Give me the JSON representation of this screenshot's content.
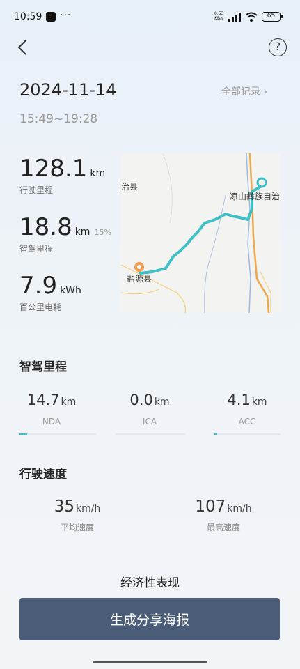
{
  "status": {
    "time": "10:59",
    "dots": "···",
    "speed_top": "0.53",
    "speed_bottom": "KB/s",
    "battery": "65"
  },
  "header": {
    "help_icon": "question-icon",
    "back_icon": "chevron-left-icon"
  },
  "trip": {
    "date": "2024-11-14",
    "time_range": "15:49~19:28",
    "all_records": "全部记录 ›"
  },
  "stats": {
    "distance": {
      "value": "128.1",
      "unit": "km",
      "label": "行驶里程"
    },
    "smart": {
      "value": "18.8",
      "unit": "km",
      "pct": "15%",
      "label": "智驾里程"
    },
    "energy": {
      "value": "7.9",
      "unit": "kWh",
      "label": "百公里电耗"
    }
  },
  "map": {
    "label_top_left": "治县",
    "label_top_right": "凉山彝族自治",
    "label_start": "盐源县"
  },
  "smart_driving": {
    "title": "智驾里程",
    "items": [
      {
        "value": "14.7",
        "unit": "km",
        "label": "NDA",
        "fill": 0.1
      },
      {
        "value": "0.0",
        "unit": "km",
        "label": "ICA",
        "fill": 0.0
      },
      {
        "value": "4.1",
        "unit": "km",
        "label": "ACC",
        "fill": 0.03
      }
    ]
  },
  "speed": {
    "title": "行驶速度",
    "avg": {
      "value": "35",
      "unit": "km/h",
      "label": "平均速度"
    },
    "max": {
      "value": "107",
      "unit": "km/h",
      "label": "最高速度"
    }
  },
  "economy": {
    "title": "经济性表现"
  },
  "share": {
    "label": "生成分享海报"
  },
  "colors": {
    "accent": "#3fbfc6",
    "button": "#4b5c78",
    "start_marker": "#f0a050"
  }
}
